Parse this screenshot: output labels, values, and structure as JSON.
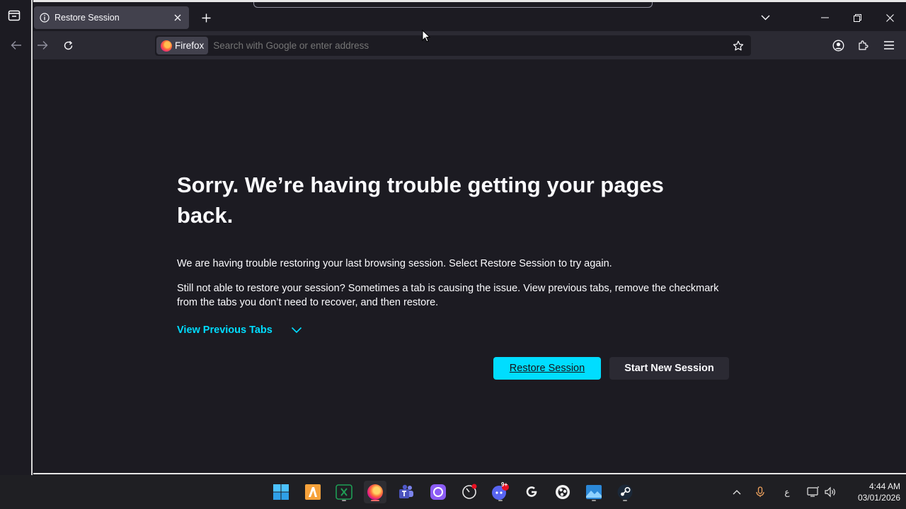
{
  "window": {
    "tab_title": "Restore Session"
  },
  "urlbar": {
    "identity_label": "Firefox",
    "placeholder": "Search with Google or enter address"
  },
  "page": {
    "heading": "Sorry. We’re having trouble getting your pages back.",
    "paragraph1": "We are having trouble restoring your last browsing session. Select Restore Session to try again.",
    "paragraph2": "Still not able to restore your session? Sometimes a tab is causing the issue. View previous tabs, remove the checkmark from the tabs you don’t need to recover, and then restore.",
    "view_previous_tabs": "View Previous Tabs",
    "restore_button": "Restore Session",
    "new_session_button": "Start New Session"
  },
  "taskbar": {
    "apps": [
      "start",
      "file-explorer-yellow",
      "excel",
      "firefox",
      "teams",
      "cortana",
      "chrome-like",
      "discord",
      "logitech",
      "obs",
      "photos",
      "steam"
    ],
    "discord_badge": "9+",
    "language": "ع",
    "time": "4:44 AM",
    "date": "03/01/2026"
  },
  "colors": {
    "accent": "#00ddff",
    "background": "#1c1b22",
    "toolbar": "#2b2a33"
  }
}
